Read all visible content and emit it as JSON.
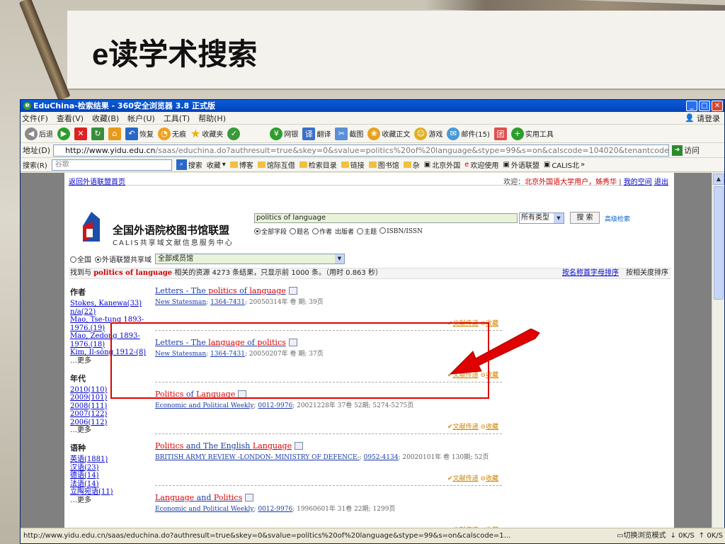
{
  "slide": {
    "title_latin": "e",
    "title_rest": "读学术搜索"
  },
  "browser": {
    "title": "EduChina-检索结果 - 360安全浏览器 3.8 正式版",
    "menu": [
      "文件(F)",
      "查看(V)",
      "收藏(B)",
      "帐户(U)",
      "工具(T)",
      "帮助(H)"
    ],
    "login": "请登录",
    "toolbar": {
      "back": "后退",
      "restore": "恢复",
      "no_trace": "无痕",
      "favorites": "收藏夹",
      "netbank": "网银",
      "translate": "翻译",
      "screenshot": "截图",
      "fav_text": "收藏正文",
      "games": "游戏",
      "mail": "邮件(15)",
      "tools": "实用工具"
    },
    "address": {
      "label": "地址(D)",
      "host": "http://www.yidu.edu.cn",
      "path": "/saas/educhina.do?authresult=true&skey=0&svalue=politics%20of%20language&stype=99&s=on&calscode=104020&tenantcode=",
      "go": "访问"
    },
    "searchbar": {
      "label": "搜索(R)",
      "placeholder": "谷歌",
      "search": "搜索",
      "favorites": "收藏",
      "links": [
        "博客",
        "馆际互借",
        "检索目录",
        "链接",
        "图书馆",
        "杂",
        "北京外国",
        "欢迎使用",
        "外语联盟",
        "CALIS北"
      ]
    },
    "status": {
      "url": "http://www.yidu.edu.cn/saas/educhina.do?authresult=true&skey=0&svalue=politics%20of%20language&stype=99&s=on&calscode=1...",
      "compat": "切换浏览模式",
      "down": "0K/S",
      "up": "0K/S"
    }
  },
  "page": {
    "back_link": "返回外语联盟首页",
    "welcome_prefix": "欢迎：",
    "welcome_org": "北京外国语大学用户，姊秀华",
    "my_space": "我的空间",
    "logout": "退出",
    "logo_name": "全国外语院校图书馆联盟",
    "logo_sub": "CALIS共享域文献信息服务中心",
    "query": "politics of language",
    "type_select": "所有类型",
    "search_btn": "搜 索",
    "advanced": "高级检索",
    "fields": [
      "全部字段",
      "题名",
      "作者",
      "出版者",
      "主题",
      "ISBN/ISSN"
    ],
    "scope_all": "全国",
    "scope_union": "外语联盟共享域",
    "scope_select": "全部成员馆",
    "summary": {
      "prefix": "找到与",
      "keyword": "politics of language",
      "rest": "相关的资源 4273 条结果，只显示前 1000 条。（用时 0.863 秒）"
    },
    "sort_alpha": "按名称首字母排序",
    "sort_relevance": "按相关度排序",
    "facets": [
      {
        "title": "作者",
        "items": [
          "Stokes, Kanewa(33)",
          "n/a(22)",
          "Mao, Tse-tung 1893-1976.(19)",
          "Mao, Zedong 1893-1976.(18)",
          "Kim, Il-sŏng 1912-(8)"
        ],
        "more": "更多"
      },
      {
        "title": "年代",
        "items": [
          "2010(110)",
          "2009(101)",
          "2008(111)",
          "2007(122)",
          "2006(112)"
        ],
        "more": "更多"
      },
      {
        "title": "语种",
        "items": [
          "英语(1881)",
          "汉语(23)",
          "德语(14)",
          "法语(14)",
          "立陶宛语(11)"
        ],
        "more": "更多"
      }
    ],
    "results": [
      {
        "t1": "Letters - The ",
        "h1": "politics",
        "t2": " of ",
        "h2": "language",
        "t3": "",
        "src": "New Statesman",
        "issn": "1364-7431",
        "tail": "; 20050314年 卷 期; 39页"
      },
      {
        "t1": "Letters - The ",
        "h1": "language",
        "t2": " of ",
        "h2": "politics",
        "t3": "",
        "src": "New Statesman",
        "issn": "1364-7431",
        "tail": "; 20050207年 卷 期; 37页"
      },
      {
        "t1": "",
        "h1": "Politics",
        "t2": " of ",
        "h2": "Language",
        "t3": "",
        "src": "Economic and Political Weekly",
        "issn": "0012-9976",
        "tail": "; 20021228年 37卷 52期; 5274-5275页"
      },
      {
        "t1": "",
        "h1": "Politics",
        "t2": " and The English ",
        "h2": "Language",
        "t3": "",
        "src": "BRITISH ARMY REVIEW -LONDON- MINISTRY OF DEFENCE-",
        "issn": "0952-4134",
        "tail": "; 20020101年 卷 130期; 52页"
      },
      {
        "t1": "",
        "h1": "Language",
        "t2": " and ",
        "h2": "Politics",
        "t3": "",
        "src": "Economic and Political Weekly",
        "issn": "0012-9976",
        "tail": "; 19960601年 31卷 22期; 1299页"
      }
    ],
    "action_deliver": "文献传递",
    "action_collect": "收藏"
  },
  "colors": {
    "highlight_box": "#e00000",
    "arrow": "#e00000",
    "title_bar": "#0a5bd8"
  }
}
